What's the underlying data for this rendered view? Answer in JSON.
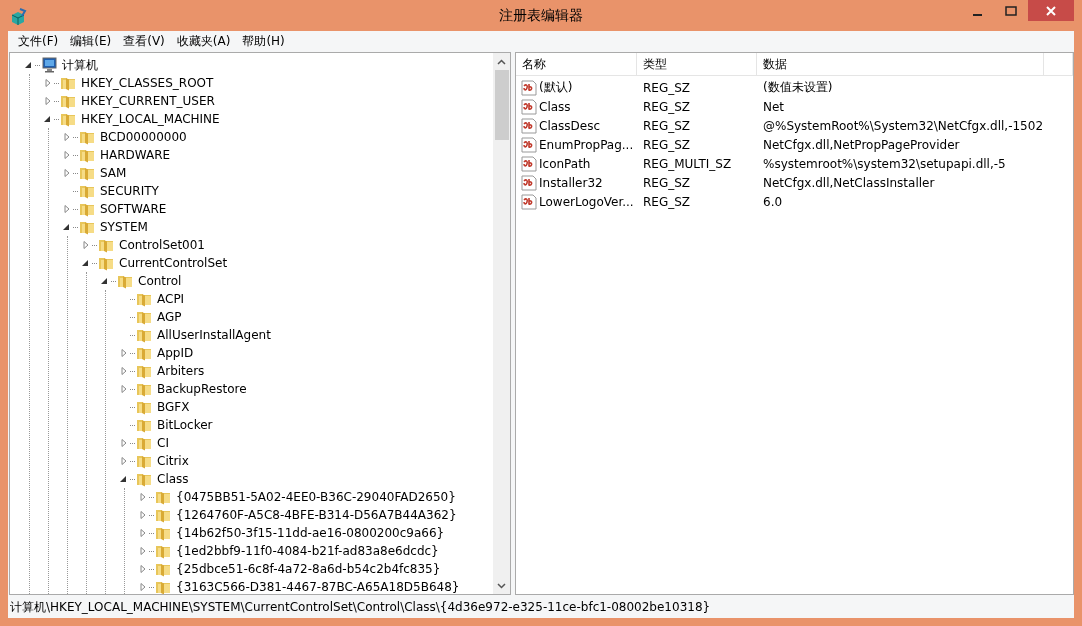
{
  "window": {
    "title": "注册表编辑器"
  },
  "menu": [
    "文件(F)",
    "编辑(E)",
    "查看(V)",
    "收藏夹(A)",
    "帮助(H)"
  ],
  "tree": {
    "label": "计算机",
    "expanded": true,
    "children": [
      {
        "label": "HKEY_CLASSES_ROOT",
        "expandable": true,
        "expanded": false
      },
      {
        "label": "HKEY_CURRENT_USER",
        "expandable": true,
        "expanded": false
      },
      {
        "label": "HKEY_LOCAL_MACHINE",
        "expandable": true,
        "expanded": true,
        "children": [
          {
            "label": "BCD00000000",
            "expandable": true,
            "expanded": false
          },
          {
            "label": "HARDWARE",
            "expandable": true,
            "expanded": false
          },
          {
            "label": "SAM",
            "expandable": true,
            "expanded": false
          },
          {
            "label": "SECURITY",
            "expandable": false,
            "expanded": false
          },
          {
            "label": "SOFTWARE",
            "expandable": true,
            "expanded": false
          },
          {
            "label": "SYSTEM",
            "expandable": true,
            "expanded": true,
            "children": [
              {
                "label": "ControlSet001",
                "expandable": true,
                "expanded": false
              },
              {
                "label": "CurrentControlSet",
                "expandable": true,
                "expanded": true,
                "children": [
                  {
                    "label": "Control",
                    "expandable": true,
                    "expanded": true,
                    "children": [
                      {
                        "label": "ACPI",
                        "expandable": false,
                        "expanded": false
                      },
                      {
                        "label": "AGP",
                        "expandable": false,
                        "expanded": false
                      },
                      {
                        "label": "AllUserInstallAgent",
                        "expandable": false,
                        "expanded": false
                      },
                      {
                        "label": "AppID",
                        "expandable": true,
                        "expanded": false
                      },
                      {
                        "label": "Arbiters",
                        "expandable": true,
                        "expanded": false
                      },
                      {
                        "label": "BackupRestore",
                        "expandable": true,
                        "expanded": false
                      },
                      {
                        "label": "BGFX",
                        "expandable": false,
                        "expanded": false
                      },
                      {
                        "label": "BitLocker",
                        "expandable": false,
                        "expanded": false
                      },
                      {
                        "label": "CI",
                        "expandable": true,
                        "expanded": false
                      },
                      {
                        "label": "Citrix",
                        "expandable": true,
                        "expanded": false
                      },
                      {
                        "label": "Class",
                        "expandable": true,
                        "expanded": true,
                        "children": [
                          {
                            "label": "{0475BB51-5A02-4EE0-B36C-29040FAD2650}",
                            "expandable": true,
                            "expanded": false
                          },
                          {
                            "label": "{1264760F-A5C8-4BFE-B314-D56A7B44A362}",
                            "expandable": true,
                            "expanded": false
                          },
                          {
                            "label": "{14b62f50-3f15-11dd-ae16-0800200c9a66}",
                            "expandable": true,
                            "expanded": false
                          },
                          {
                            "label": "{1ed2bbf9-11f0-4084-b21f-ad83a8e6dcdc}",
                            "expandable": true,
                            "expanded": false
                          },
                          {
                            "label": "{25dbce51-6c8f-4a72-8a6d-b54c2b4fc835}",
                            "expandable": true,
                            "expanded": false
                          },
                          {
                            "label": "{3163C566-D381-4467-87BC-A65A18D5B648}",
                            "expandable": true,
                            "expanded": false
                          }
                        ]
                      }
                    ]
                  }
                ]
              }
            ]
          }
        ]
      }
    ]
  },
  "values": {
    "columns": [
      "名称",
      "类型",
      "数据"
    ],
    "rows": [
      {
        "name": "(默认)",
        "type": "REG_SZ",
        "data": "(数值未设置)"
      },
      {
        "name": "Class",
        "type": "REG_SZ",
        "data": "Net"
      },
      {
        "name": "ClassDesc",
        "type": "REG_SZ",
        "data": "@%SystemRoot%\\System32\\NetCfgx.dll,-1502"
      },
      {
        "name": "EnumPropPag...",
        "type": "REG_SZ",
        "data": "NetCfgx.dll,NetPropPageProvider"
      },
      {
        "name": "IconPath",
        "type": "REG_MULTI_SZ",
        "data": "%systemroot%\\system32\\setupapi.dll,-5"
      },
      {
        "name": "Installer32",
        "type": "REG_SZ",
        "data": "NetCfgx.dll,NetClassInstaller"
      },
      {
        "name": "LowerLogoVer...",
        "type": "REG_SZ",
        "data": "6.0"
      }
    ]
  },
  "status_bar": "计算机\\HKEY_LOCAL_MACHINE\\SYSTEM\\CurrentControlSet\\Control\\Class\\{4d36e972-e325-11ce-bfc1-08002be10318}"
}
